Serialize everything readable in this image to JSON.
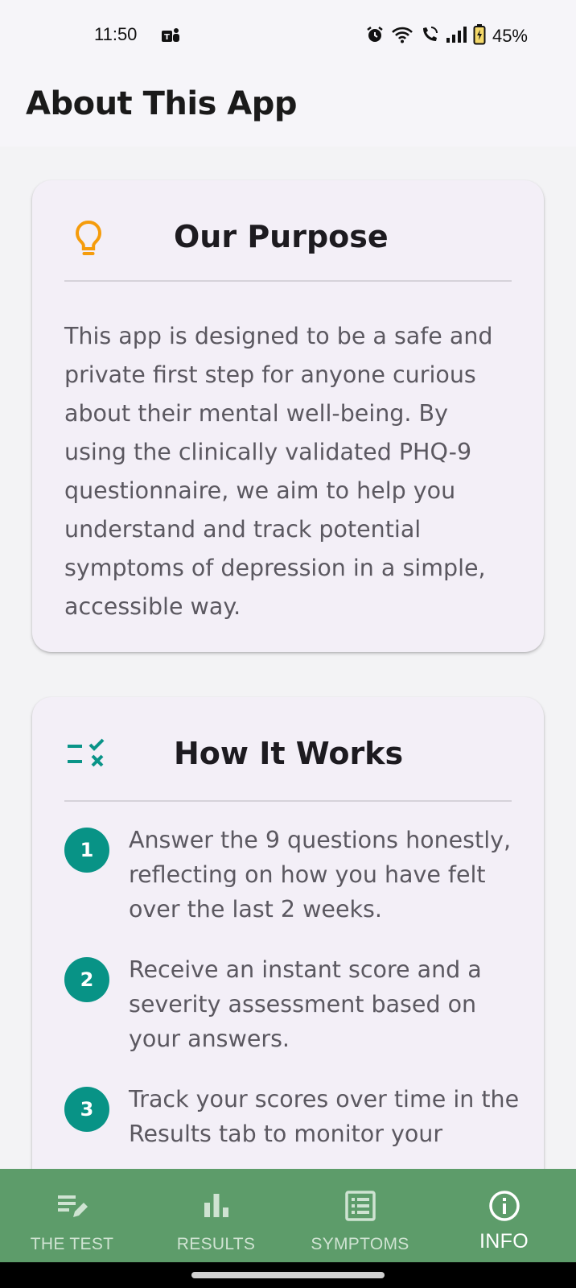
{
  "status_bar": {
    "time": "11:50",
    "battery": "45%",
    "icons": [
      "teams-icon",
      "alarm-icon",
      "wifi-icon",
      "wifi-call-icon",
      "signal-icon",
      "battery-charging-icon"
    ]
  },
  "app_bar": {
    "title": "About This App"
  },
  "purpose_card": {
    "icon": "lightbulb-icon",
    "icon_color": "#f59c0c",
    "title": "Our Purpose",
    "body": "This app is designed to be a safe and private first step for anyone curious about their mental well-being. By using the clinically validated PHQ-9 questionnaire, we aim to help you understand and track potential symptoms of depression in a simple, accessible way."
  },
  "how_card": {
    "icon": "checklist-icon",
    "icon_color": "#0a9488",
    "title": "How It Works",
    "steps": [
      {
        "number": "1",
        "text": "Answer the 9 questions honestly, reflecting on how you have felt over the last 2 weeks."
      },
      {
        "number": "2",
        "text": "Receive an instant score and a severity assessment based on your answers."
      },
      {
        "number": "3",
        "text": "Track your scores over time in the Results tab to monitor your"
      }
    ]
  },
  "bottom_nav": {
    "background": "#5d9c6a",
    "items": [
      {
        "label": "THE TEST",
        "icon": "edit-list-icon",
        "active": false
      },
      {
        "label": "RESULTS",
        "icon": "bar-chart-icon",
        "active": false
      },
      {
        "label": "SYMPTOMS",
        "icon": "list-alt-icon",
        "active": false
      },
      {
        "label": "INFO",
        "icon": "info-icon",
        "active": true
      }
    ]
  }
}
